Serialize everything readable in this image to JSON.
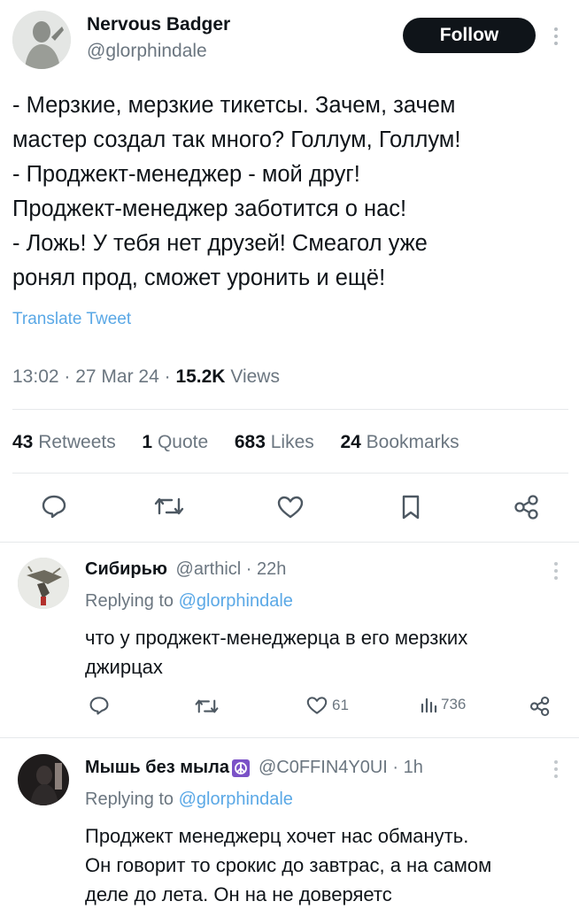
{
  "main_tweet": {
    "author_name": "Nervous Badger",
    "author_handle": "@glorphindale",
    "follow_label": "Follow",
    "text": "- Мерзкие, мерзкие тикетсы. Зачем, зачем\nмастер создал так много? Голлум, Голлум!\n- Проджект-менеджер - мой друг!\nПроджект-менеджер заботится о нас!\n- Ложь! У тебя нет друзей! Смеагол уже\nронял прод, сможет уронить и ещё!",
    "translate_label": "Translate Tweet",
    "timestamp": "13:02 · 27 Mar 24 · ",
    "views_count": "15.2K",
    "views_label": " Views",
    "stats": {
      "retweets_count": "43",
      "retweets_label": " Retweets",
      "quotes_count": "1",
      "quotes_label": " Quote",
      "likes_count": "683",
      "likes_label": " Likes",
      "bookmarks_count": "24",
      "bookmarks_label": " Bookmarks"
    }
  },
  "replies": [
    {
      "author_name": "Сибирью",
      "handle_time": "@arthicl · 22h",
      "replying_prefix": "Replying to ",
      "replying_handle": "@glorphindale",
      "text": "что у проджект-менеджерца в его мерзких\nджирцах",
      "likes": "61",
      "views": "736"
    },
    {
      "author_name": "Мышь без мыла",
      "handle_time": "@C0FFIN4Y0UI · 1h",
      "replying_prefix": "Replying to ",
      "replying_handle": "@glorphindale",
      "text": "Проджект менеджерц хочет нас обмануть.\nОн говорит то срокис до завтрас, а на самом\nделе до лета. Он на не доверяетс"
    }
  ],
  "colors": {
    "accent": "#1d9bf0",
    "muted": "#6b7680",
    "text": "#0f1419",
    "emoji_bg": "#7b52c7"
  }
}
